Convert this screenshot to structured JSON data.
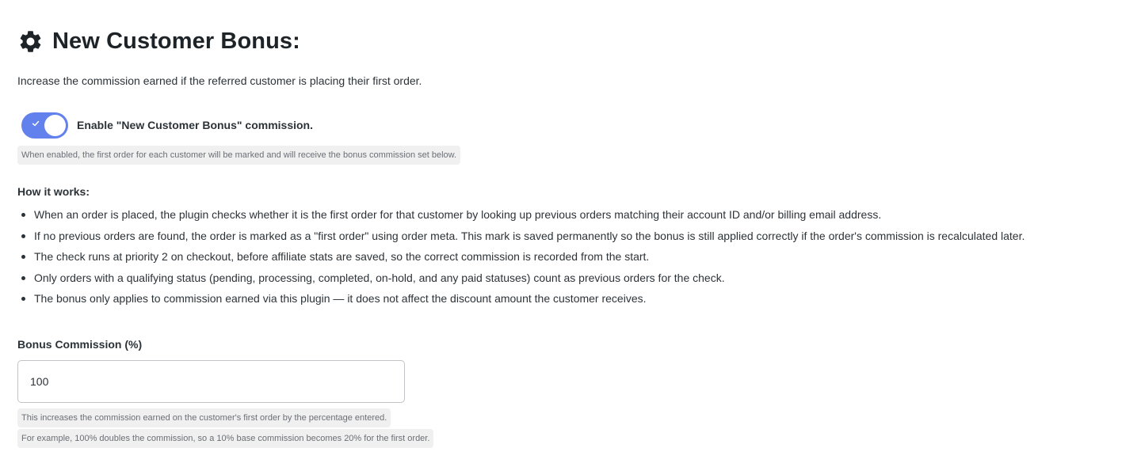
{
  "header": {
    "icon": "gear-icon",
    "title": "New Customer Bonus:"
  },
  "description": "Increase the commission earned if the referred customer is placing their first order.",
  "toggle": {
    "enabled": true,
    "label": "Enable \"New Customer Bonus\" commission.",
    "hint": "When enabled, the first order for each customer will be marked and will receive the bonus commission set below.",
    "accent_color": "#6381ec"
  },
  "how_it_works": {
    "title": "How it works:",
    "items": [
      "When an order is placed, the plugin checks whether it is the first order for that customer by looking up previous orders matching their account ID and/or billing email address.",
      "If no previous orders are found, the order is marked as a \"first order\" using order meta. This mark is saved permanently so the bonus is still applied correctly if the order's commission is recalculated later.",
      "The check runs at priority 2 on checkout, before affiliate stats are saved, so the correct commission is recorded from the start.",
      "Only orders with a qualifying status (pending, processing, completed, on-hold, and any paid statuses) count as previous orders for the check.",
      "The bonus only applies to commission earned via this plugin — it does not affect the discount amount the customer receives."
    ]
  },
  "bonus_field": {
    "label": "Bonus Commission (%)",
    "value": "100",
    "hints": [
      "This increases the commission earned on the customer's first order by the percentage entered.",
      "For example, 100% doubles the commission, so a 10% base commission becomes 20% for the first order."
    ]
  }
}
